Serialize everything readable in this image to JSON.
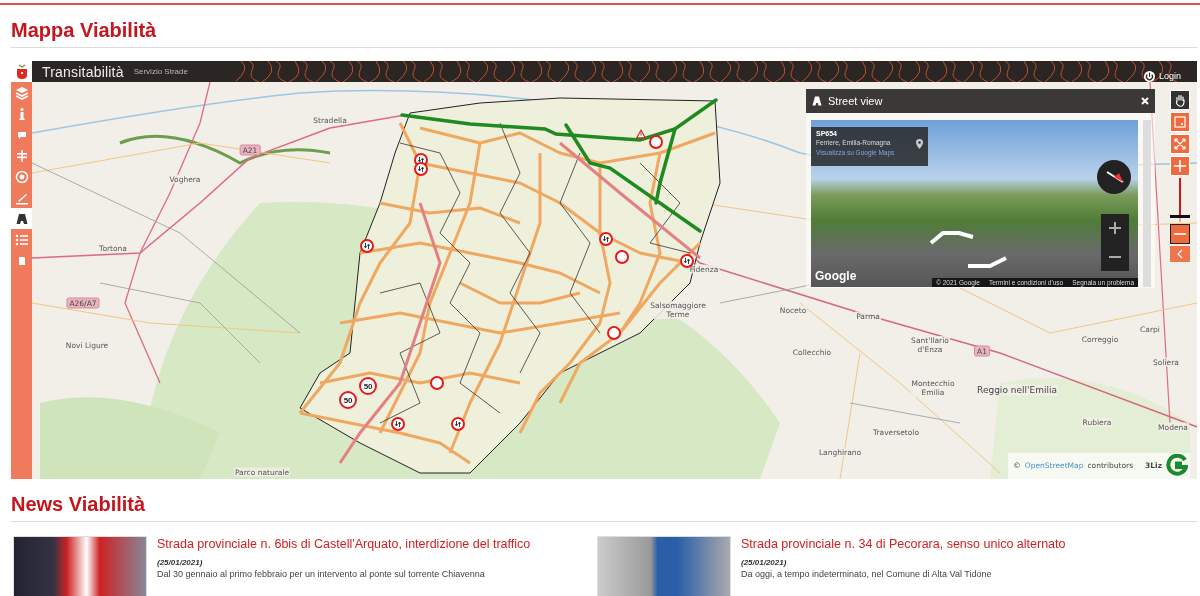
{
  "page_title": "Mappa Viabilità",
  "map": {
    "app_title": "Transitabilità",
    "app_subtitle": "Servizio Strade",
    "login": "Login",
    "tools": [
      {
        "kind": "layers",
        "selected": false
      },
      {
        "kind": "info",
        "selected": false
      },
      {
        "kind": "comment",
        "selected": false
      },
      {
        "kind": "signpost",
        "selected": false
      },
      {
        "kind": "target",
        "selected": false
      },
      {
        "kind": "edit",
        "selected": false
      },
      {
        "kind": "street",
        "selected": true
      },
      {
        "kind": "list",
        "selected": false
      },
      {
        "kind": "print",
        "selected": false
      }
    ],
    "place_labels": [
      {
        "text": "Stradella"
      },
      {
        "text": "Voghera"
      },
      {
        "text": "Tortona"
      },
      {
        "text": "Novi Ligure"
      },
      {
        "text": "Parco naturale"
      },
      {
        "text": "Fidenza"
      },
      {
        "text": "Salsomaggiore\nTerme"
      },
      {
        "text": "Noceto"
      },
      {
        "text": "Parma"
      },
      {
        "text": "Collecchio"
      },
      {
        "text": "Sant'Ilario\nd'Enza"
      },
      {
        "text": "Montecchio\nEmilia"
      },
      {
        "text": "Traversetolo"
      },
      {
        "text": "Langhirano"
      },
      {
        "text": "Reggio nell'Emilia"
      },
      {
        "text": "Correggio"
      },
      {
        "text": "Carpi"
      },
      {
        "text": "Soliera"
      },
      {
        "text": "Rubiera"
      },
      {
        "text": "Modena"
      }
    ],
    "road_labels": [
      {
        "text": "A21"
      },
      {
        "text": "A26/A7"
      },
      {
        "text": "A1"
      }
    ],
    "signs": [
      {
        "kind": "alternating"
      },
      {
        "kind": "alternating"
      },
      {
        "kind": "alternating"
      },
      {
        "kind": "alternating"
      },
      {
        "kind": "closure"
      },
      {
        "kind": "alternating"
      },
      {
        "kind": "closure"
      },
      {
        "kind": "closure"
      },
      {
        "kind": "speed",
        "text": "50"
      },
      {
        "kind": "speed",
        "text": "50"
      },
      {
        "kind": "alternating"
      },
      {
        "kind": "alternating"
      },
      {
        "kind": "closure"
      },
      {
        "kind": "warning"
      }
    ],
    "street_view": {
      "title": "Street view",
      "road": "SP654",
      "place": "Ferriere, Emilia-Romagna",
      "link": "Visualizza su Google Maps",
      "brand": "Google",
      "footer": [
        "© 2021 Google",
        "Termini e condizioni d'uso",
        "Segnala un problema"
      ]
    },
    "zoom": {
      "level": 0.1
    },
    "attribution": {
      "prefix": "©",
      "link": "OpenStreetMap",
      "suffix": "contributors",
      "logo": "3Liz"
    }
  },
  "news_title": "News Viabilità",
  "news": [
    {
      "title": "Strada provinciale n. 6bis di Castell'Arquato, interdizione del traffico",
      "date": "(25/01/2021)",
      "text": "Dal 30 gennaio al primo febbraio per un intervento al ponte sul torrente Chiavenna"
    },
    {
      "title": "Strada provinciale n. 34 di Pecorara, senso unico alternato",
      "date": "(25/01/2021)",
      "text": "Da oggi, a tempo indeterminato, nel Comune di Alta Val Tidone"
    }
  ]
}
